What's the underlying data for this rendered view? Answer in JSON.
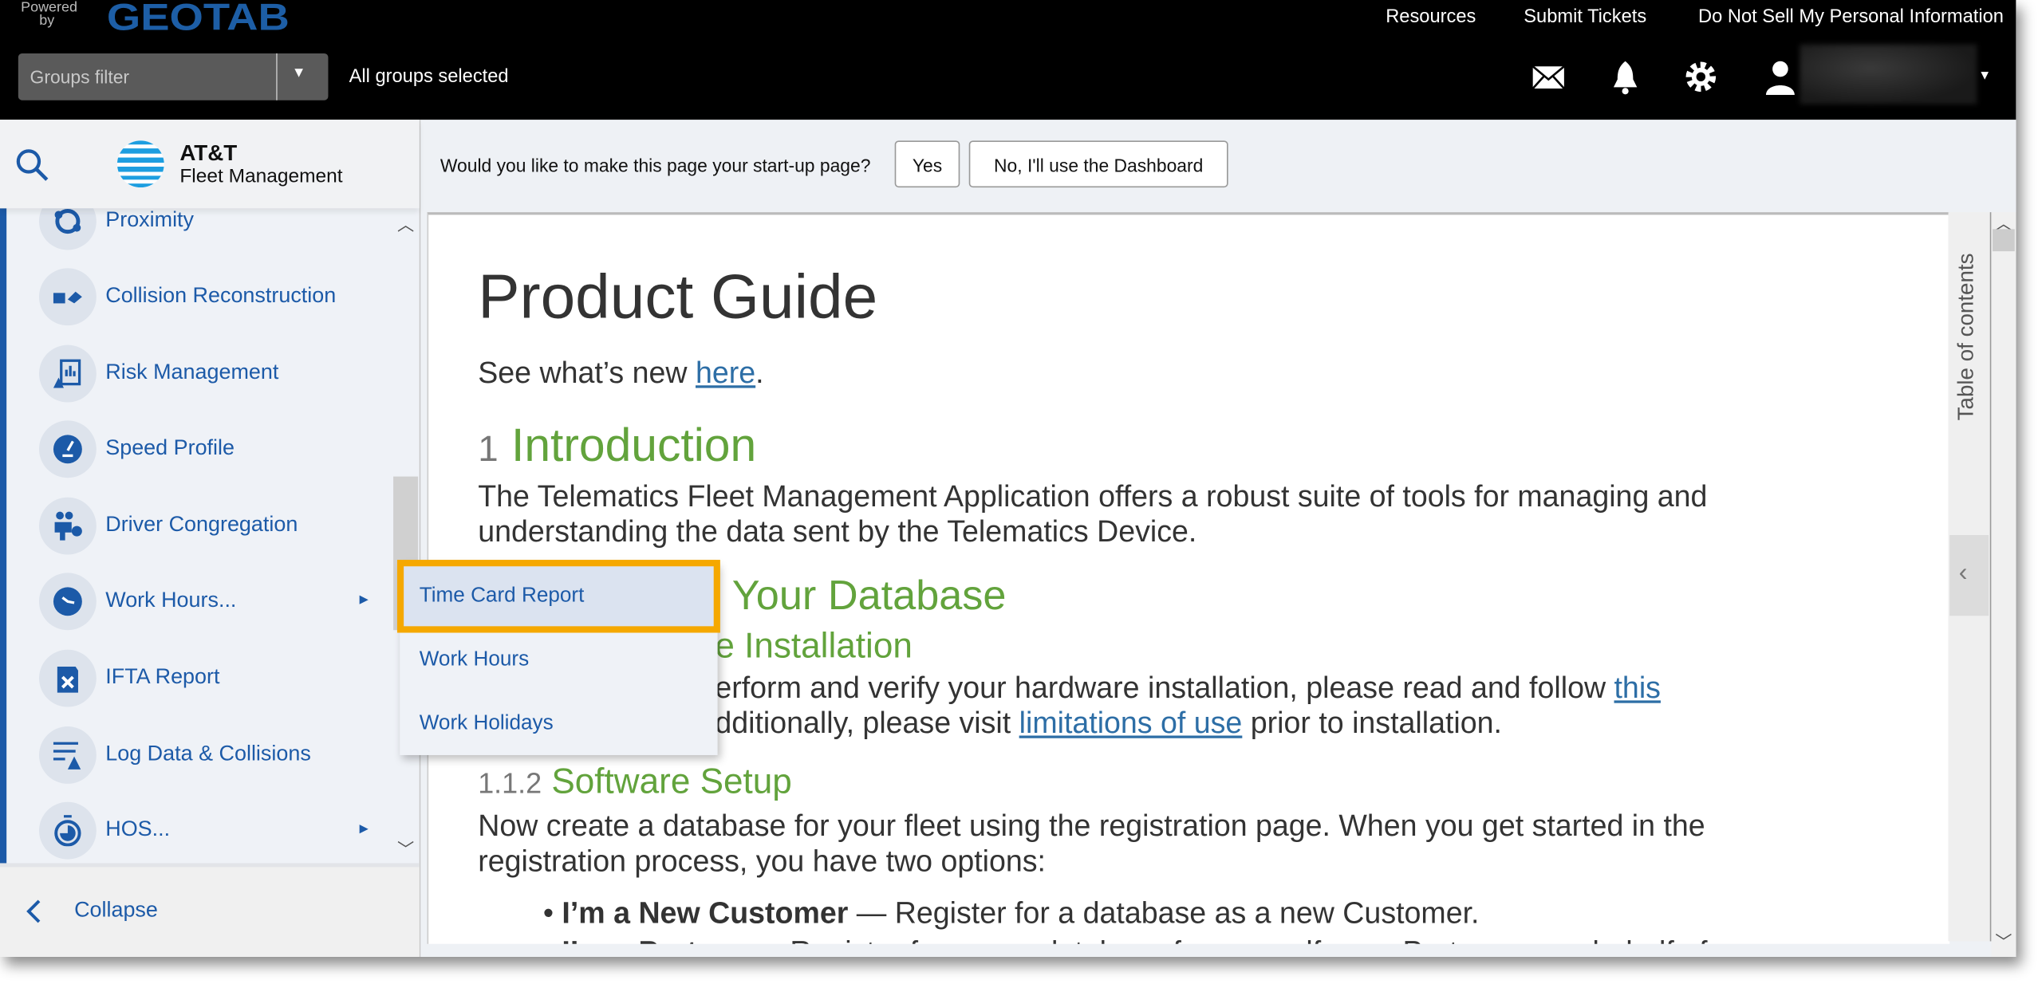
{
  "header": {
    "logo_powered": "Powered by",
    "logo_brand": "GEOTAB",
    "links": [
      "Resources",
      "Submit Tickets",
      "Do Not Sell My Personal Information"
    ],
    "groups_filter_placeholder": "Groups filter",
    "groups_status": "All groups selected",
    "icons": [
      "mail-icon",
      "bell-icon",
      "gear-icon",
      "user-icon"
    ]
  },
  "sidebar": {
    "brand_title": "AT&T",
    "brand_subtitle": "Fleet Management",
    "items": [
      {
        "label": "Proximity",
        "icon": "proximity-icon"
      },
      {
        "label": "Collision Reconstruction",
        "icon": "collision-icon"
      },
      {
        "label": "Risk Management",
        "icon": "risk-icon"
      },
      {
        "label": "Speed Profile",
        "icon": "speedometer-icon"
      },
      {
        "label": "Driver Congregation",
        "icon": "drivers-icon"
      },
      {
        "label": "Work Hours...",
        "icon": "clock-icon",
        "submenu": true
      },
      {
        "label": "IFTA Report",
        "icon": "fuel-can-icon"
      },
      {
        "label": "Log Data & Collisions",
        "icon": "log-icon"
      },
      {
        "label": "HOS...",
        "icon": "stopwatch-icon",
        "submenu": true
      }
    ],
    "collapse_label": "Collapse"
  },
  "submenu": {
    "items": [
      "Time Card Report",
      "Work Hours",
      "Work Holidays"
    ],
    "highlighted": "Time Card Report",
    "highlight_color": "#f5a800"
  },
  "banner": {
    "question": "Would you like to make this page your start-up page?",
    "yes_label": "Yes",
    "no_label": "No, I'll use the Dashboard"
  },
  "guide": {
    "title": "Product Guide",
    "whats_new_prefix": "See what’s new ",
    "whats_new_link": "here",
    "whats_new_suffix": ".",
    "intro_num": "1",
    "intro_title": "Introduction",
    "intro_line1": "The Telematics Fleet Management Application offers a robust suite of tools for managing and",
    "intro_line2": "understanding the data sent by the Telematics Device.",
    "db_heading_visible": "o Your Database",
    "hw_heading_visible": "e Installation",
    "hw_line1_visible": "erform and verify your hardware installation, please read and follow ",
    "hw_line1_link": "this",
    "hw_line2_visible": "dditionally, please visit ",
    "hw_line2_link": "limitations of use",
    "hw_line2_suffix": " prior to installation.",
    "sw_num": "1.1.2",
    "sw_title": "Software Setup",
    "sw_line1": "Now create a database for your fleet using the registration page. When you get started in the",
    "sw_line2": "registration process, you have two options:",
    "bullet1_bold": "I’m a New Customer",
    "bullet1_text": " — Register for a database as a new Customer.",
    "bullet2_bold": "I’m a Partner",
    "bullet2_text": " — Register for a new database for yourself, as a Partner, or on behalf of a"
  },
  "toc": {
    "label": "Table of contents"
  },
  "colors": {
    "accent": "#1c5aa8",
    "heading_green": "#62a33c",
    "topbar": "#000000"
  }
}
